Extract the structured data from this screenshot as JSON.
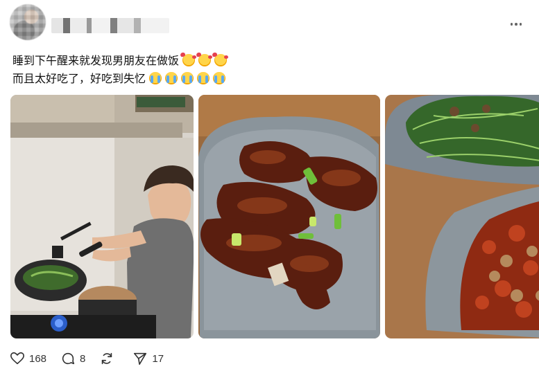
{
  "post": {
    "line1": {
      "text": "睡到下午醒来就发现男朋友在做饭",
      "emoji": "smiling-face-with-hearts",
      "emoji_count": 3
    },
    "line2": {
      "text": "而且太好吃了，好吃到失忆",
      "emoji": "loudly-crying-face",
      "emoji_count": 5
    }
  },
  "media": {
    "photos": [
      {
        "name": "photo-cooking",
        "desc_icon": "man-cooking-photo"
      },
      {
        "name": "photo-ribs",
        "desc_icon": "braised-ribs-photo"
      },
      {
        "name": "photo-dishes",
        "desc_icon": "vegetables-and-chili-chicken-photo"
      }
    ]
  },
  "actions": {
    "like_count": "168",
    "reply_count": "8",
    "repost_count": "",
    "share_count": "17"
  },
  "colors": {
    "icon_gray": "#333333",
    "background": "#ffffff"
  }
}
